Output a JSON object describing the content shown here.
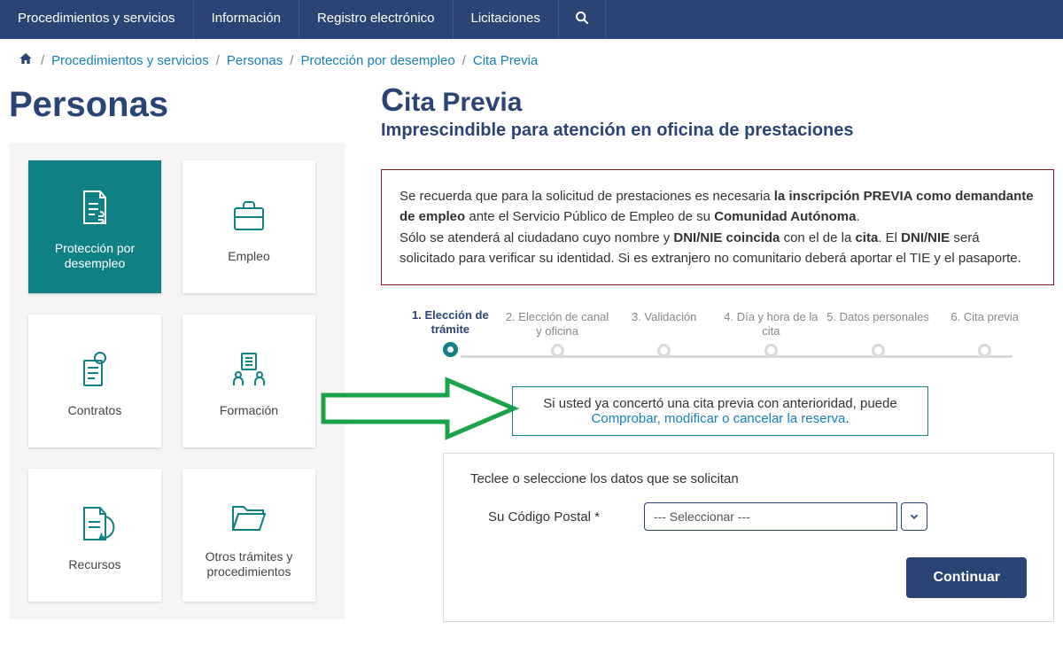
{
  "nav": {
    "items": [
      "Procedimientos y servicios",
      "Información",
      "Registro electrónico",
      "Licitaciones"
    ]
  },
  "breadcrumb": {
    "items": [
      "Procedimientos y servicios",
      "Personas",
      "Protección por desempleo",
      "Cita Previa"
    ]
  },
  "left": {
    "title": "Personas",
    "cards": [
      {
        "label": "Protección por desempleo"
      },
      {
        "label": "Empleo"
      },
      {
        "label": "Contratos"
      },
      {
        "label": "Formación"
      },
      {
        "label": "Recursos"
      },
      {
        "label": "Otros trámites y procedimientos"
      }
    ]
  },
  "right": {
    "title_cap": "C",
    "title_rest": "ita Previa",
    "subtitle": "Imprescindible para atención en oficina de prestaciones",
    "notice": {
      "p1a": "Se recuerda que para la solicitud de prestaciones es necesaria ",
      "p1b": "la inscripción PREVIA como demandante de empleo",
      "p1c": " ante el Servicio Público de Empleo de su ",
      "p1d": "Comunidad Autónoma",
      "p1e": ".",
      "p2a": "Sólo se atenderá al ciudadano cuyo nombre y ",
      "p2b": "DNI/NIE coincida",
      "p2c": " con el de la ",
      "p2d": "cita",
      "p2e": ". El ",
      "p2f": "DNI/NIE",
      "p2g": " será solicitado para verificar su identidad. Si es extranjero no comunitario deberá aportar el TIE y el pasaporte."
    },
    "steps": [
      "1. Elección de trámite",
      "2. Elección de canal y oficina",
      "3. Validación",
      "4. Día y hora de la cita",
      "5. Datos personales",
      "6. Cita previa"
    ],
    "linkbox": {
      "line1": "Si usted ya concertó una cita previa con anterioridad, puede",
      "link": "Comprobar, modificar o cancelar la reserva",
      "suffix": "."
    },
    "form": {
      "prompt": "Teclee o seleccione los datos que se solicitan",
      "cp_label": "Su Código Postal *",
      "cp_placeholder": "--- Seleccionar ---",
      "continue": "Continuar"
    }
  }
}
